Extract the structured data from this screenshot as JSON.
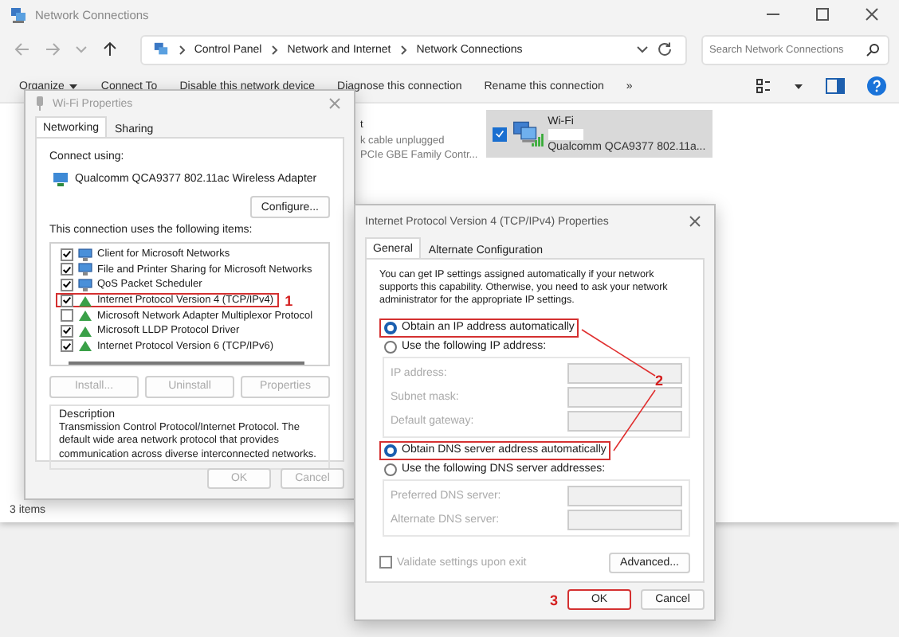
{
  "explorer": {
    "title": "Network Connections",
    "breadcrumb": [
      "Control Panel",
      "Network and Internet",
      "Network Connections"
    ],
    "search": {
      "placeholder": "Search Network Connections"
    },
    "toolbar": [
      {
        "label": "Organize",
        "kind": "menu"
      },
      {
        "label": "Connect To",
        "kind": "command"
      },
      {
        "label": "Disable this network device",
        "kind": "command"
      },
      {
        "label": "Diagnose this connection",
        "kind": "command"
      },
      {
        "label": "Rename this connection",
        "kind": "command"
      },
      {
        "label": "»",
        "kind": "command"
      }
    ],
    "connections": [
      {
        "kind": "partial",
        "lines": [
          "t",
          "k cable unplugged",
          "PCIe GBE Family Contr..."
        ]
      },
      {
        "kind": "tile",
        "name": "Wi-Fi",
        "adapter": "Qualcomm QCA9377 802.11a...",
        "selected": true
      }
    ],
    "status_bar": "3 items"
  },
  "wifi_properties": {
    "title": "Wi-Fi Properties",
    "tabs": [
      {
        "label": "Networking",
        "selected": true
      },
      {
        "label": "Sharing",
        "selected": false
      }
    ],
    "connect_using_label": "Connect using:",
    "adapter": "Qualcomm QCA9377 802.11ac Wireless Adapter",
    "configure_button": "Configure...",
    "items_label": "This connection uses the following items:",
    "items": [
      {
        "label": "Client for Microsoft Networks",
        "kind": "service",
        "checked": true,
        "annotated": false
      },
      {
        "label": "File and Printer Sharing for Microsoft Networks",
        "kind": "service",
        "checked": true,
        "annotated": false
      },
      {
        "label": "QoS Packet Scheduler",
        "kind": "service",
        "checked": true,
        "annotated": false
      },
      {
        "label": "Internet Protocol Version 4 (TCP/IPv4)",
        "kind": "protocol",
        "checked": true,
        "annotated": true,
        "annotation": "1"
      },
      {
        "label": "Microsoft Network Adapter Multiplexor Protocol",
        "kind": "protocol",
        "checked": false,
        "annotated": false
      },
      {
        "label": "Microsoft LLDP Protocol Driver",
        "kind": "protocol",
        "checked": true,
        "annotated": false
      },
      {
        "label": "Internet Protocol Version 6 (TCP/IPv6)",
        "kind": "protocol",
        "checked": true,
        "annotated": false
      }
    ],
    "item_buttons": [
      {
        "label": "Install...",
        "disabled": true
      },
      {
        "label": "Uninstall",
        "disabled": true
      },
      {
        "label": "Properties",
        "disabled": true
      }
    ],
    "description_label": "Description",
    "description": "Transmission Control Protocol/Internet Protocol. The default wide area network protocol that provides communication across diverse interconnected networks.",
    "buttons": [
      {
        "label": "OK",
        "disabled": true
      },
      {
        "label": "Cancel",
        "disabled": true
      }
    ]
  },
  "ipv4_properties": {
    "title": "Internet Protocol Version 4 (TCP/IPv4) Properties",
    "tabs": [
      {
        "label": "General",
        "selected": true
      },
      {
        "label": "Alternate Configuration",
        "selected": false
      }
    ],
    "intro": "You can get IP settings assigned automatically if your network supports this capability. Otherwise, you need to ask your network administrator for the appropriate IP settings.",
    "ip_options": [
      {
        "label": "Obtain an IP address automatically",
        "selected": true,
        "annotated": true
      },
      {
        "label": "Use the following IP address:",
        "selected": false,
        "annotated": false
      }
    ],
    "ip_fields": [
      {
        "label": "IP address:",
        "disabled": true
      },
      {
        "label": "Subnet mask:",
        "disabled": true
      },
      {
        "label": "Default gateway:",
        "disabled": true
      }
    ],
    "dns_options": [
      {
        "label": "Obtain DNS server address automatically",
        "selected": true,
        "annotated": true
      },
      {
        "label": "Use the following DNS server addresses:",
        "selected": false,
        "annotated": false
      }
    ],
    "dns_fields": [
      {
        "label": "Preferred DNS server:",
        "disabled": true
      },
      {
        "label": "Alternate DNS server:",
        "disabled": true
      }
    ],
    "validate": {
      "label": "Validate settings upon exit",
      "checked": false,
      "disabled": true
    },
    "advanced_button": "Advanced...",
    "options_annotation": "2",
    "buttons": [
      {
        "label": "OK",
        "annotated": true,
        "annotation": "3"
      },
      {
        "label": "Cancel",
        "annotated": false
      }
    ]
  }
}
